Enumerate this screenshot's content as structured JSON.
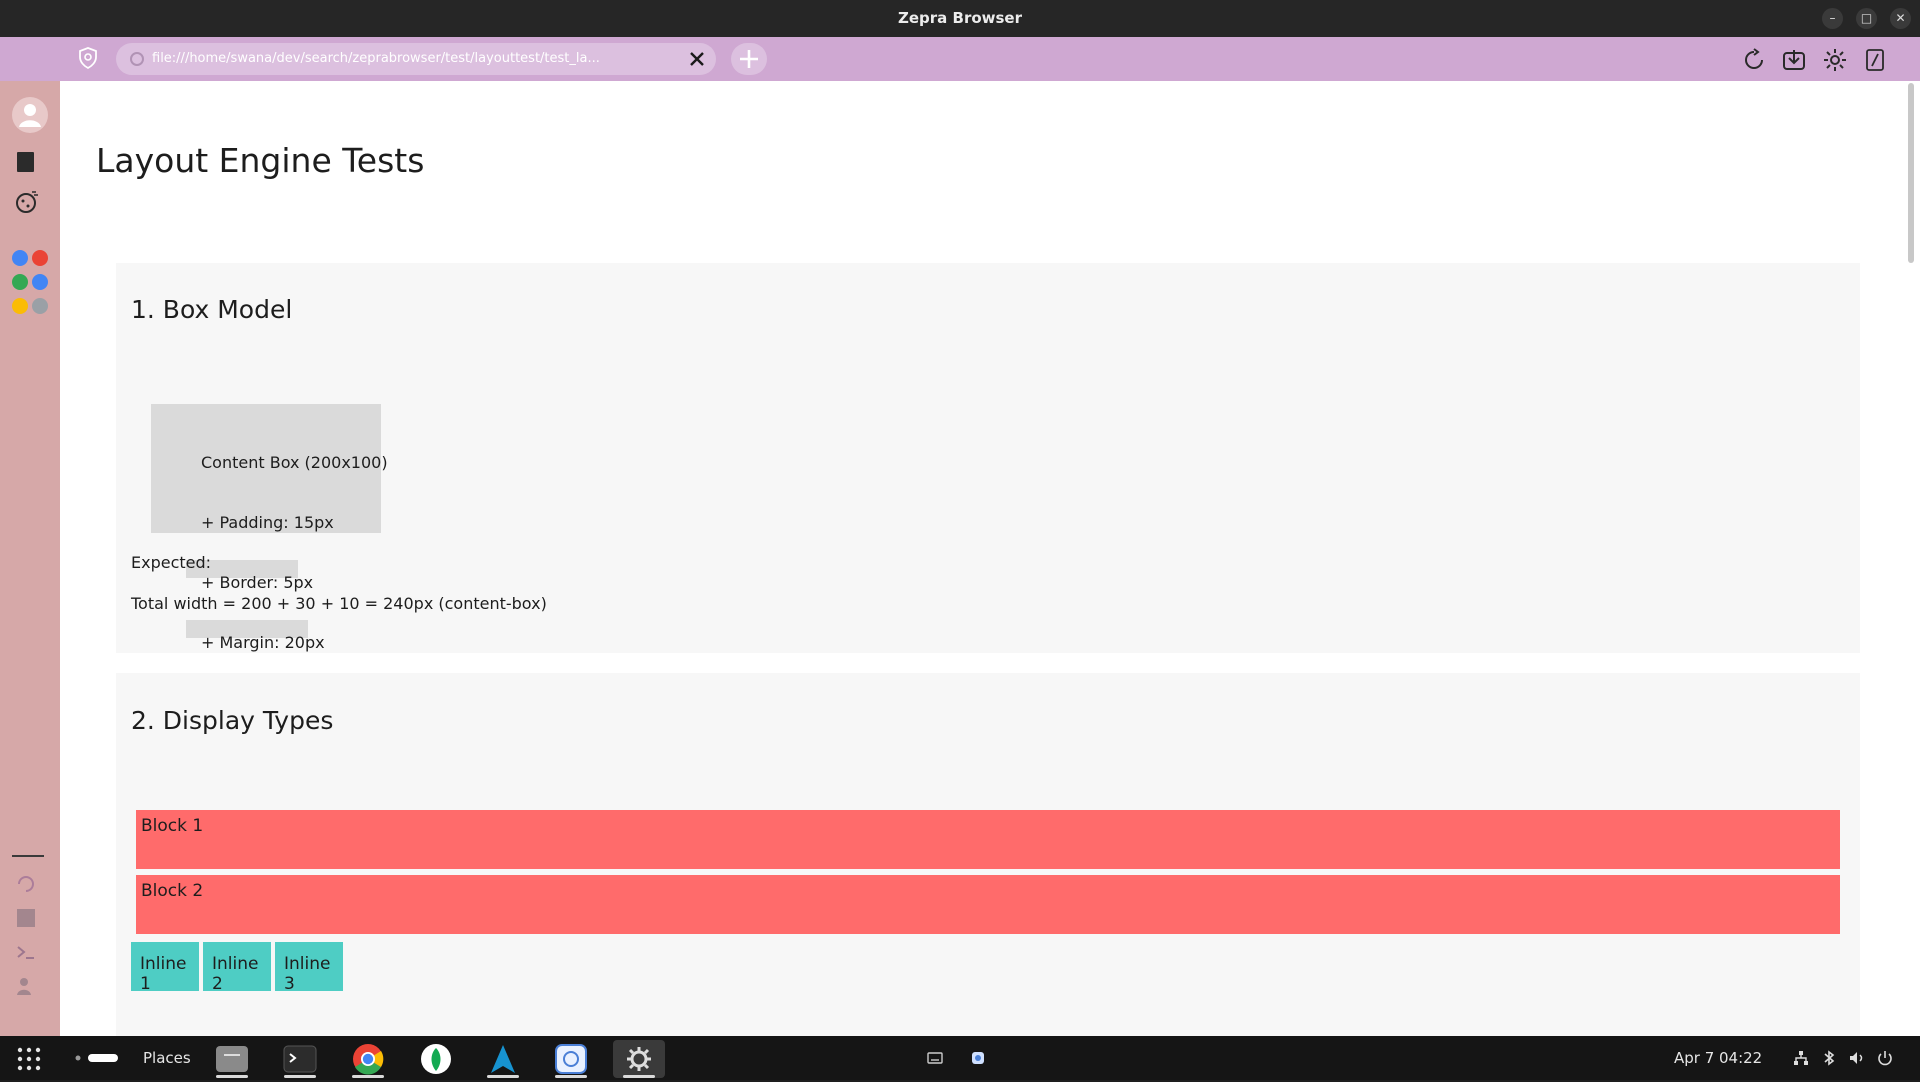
{
  "window": {
    "title": "Zepra Browser",
    "minimize_glyph": "–",
    "maximize_glyph": "□",
    "close_glyph": "✕"
  },
  "toolbar": {
    "url": "file:///home/swana/dev/search/zeprabrowser/test/layouttest/test_la..."
  },
  "page": {
    "title": "Layout Engine Tests",
    "sections": [
      {
        "heading": "1. Box Model",
        "content_box": "Content Box (200x100)",
        "padding": "+ Padding: 15px",
        "expected_label": "Expected:",
        "border": "+ Border: 5px",
        "total_width": "Total width = 200 + 30 + 10 = 240px (content-box)",
        "margin": "+ Margin: 20px"
      },
      {
        "heading": "2. Display Types",
        "blocks": [
          "Block 1",
          "Block 2"
        ],
        "inlines": [
          "Inline 1",
          "Inline 2",
          "Inline 3"
        ]
      }
    ]
  },
  "taskbar": {
    "places_label": "Places",
    "date": "Apr 7",
    "time": "04:22"
  },
  "colors": {
    "toolbar": "#cfa8d2",
    "sidebar": "#d6a8a8",
    "block": "#ff6b6b",
    "inline": "#4ecdc4",
    "section_bg": "#f7f7f7"
  },
  "icons": {
    "sidebar": [
      "avatar-icon",
      "bookmark-icon",
      "cookie-icon"
    ],
    "toolbar": [
      "reload-icon",
      "download-icon",
      "settings-icon",
      "edit-icon"
    ]
  }
}
